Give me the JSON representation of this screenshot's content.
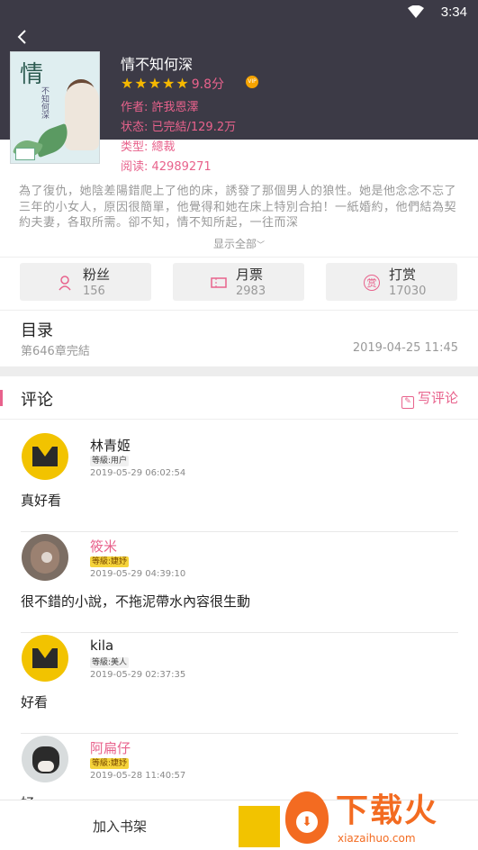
{
  "status_bar": {
    "time": "3:34",
    "wifi_icon": "wifi-icon"
  },
  "header": {
    "back_icon": "back-arrow-icon"
  },
  "book": {
    "cover_title": "情",
    "cover_subtitle": "不知何深",
    "title": "情不知何深",
    "rating_stars": 5,
    "score": "9.8分",
    "author": "作者: 許我恩澤",
    "status": "状态: 已完結/129.2万",
    "type": "类型: 總裁",
    "reads": "阅读: 42989271",
    "summary": "為了復仇，她陰差陽錯爬上了他的床，誘發了那個男人的狼性。她是他念念不忘了三年的小女人，原因很簡單，他覺得和她在床上特別合拍！一紙婚約，他們結為契約夫妻，各取所需。卻不知，情不知所起，一往而深",
    "show_all": "显示全部"
  },
  "stats": [
    {
      "label": "粉丝",
      "value": "156",
      "icon": "fans-icon"
    },
    {
      "label": "月票",
      "value": "2983",
      "icon": "ticket-icon"
    },
    {
      "label": "打赏",
      "value": "17030",
      "icon": "reward-icon",
      "icon_text": "赏"
    }
  ],
  "catalog": {
    "title": "目录",
    "chapters": "第646章完結",
    "date": "2019-04-25 11:45"
  },
  "comments_section": {
    "title": "评论",
    "write_label": "写评论"
  },
  "comments": [
    {
      "name": "林青姬",
      "level": "等級:用户",
      "time": "2019-05-29 06:02:54",
      "text": "真好看"
    },
    {
      "name": "筱米",
      "level": "等級:婕妤",
      "time": "2019-05-29 04:39:10",
      "text": "很不錯的小說，不拖泥帶水內容很生動"
    },
    {
      "name": "kila",
      "level": "等級:美人",
      "time": "2019-05-29 02:37:35",
      "text": "好看"
    },
    {
      "name": "阿扁仔",
      "level": "等級:婕妤",
      "time": "2019-05-28 11:40:57",
      "text": "好"
    }
  ],
  "bottom_bar": {
    "add_to_shelf": "加入书架"
  },
  "watermark": {
    "brand": "下载火",
    "url": "xiazaihuo.com"
  },
  "colors": {
    "header_bg": "#3c3a46",
    "accent": "#e8628c",
    "star": "#f5b800",
    "watermark": "#f36b21"
  }
}
